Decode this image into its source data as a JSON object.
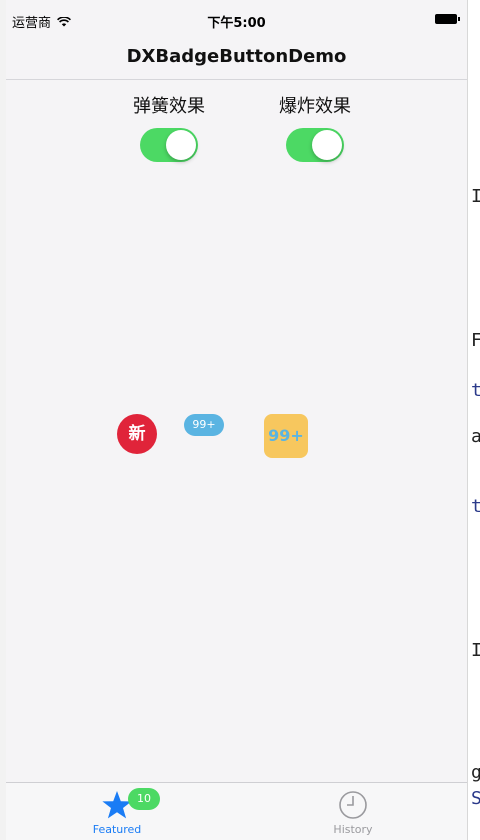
{
  "status_bar": {
    "carrier": "运营商",
    "time": "下午5:00"
  },
  "nav": {
    "title": "DXBadgeButtonDemo"
  },
  "switches": [
    {
      "label": "弹簧效果",
      "on": true
    },
    {
      "label": "爆炸效果",
      "on": true
    }
  ],
  "badges": {
    "new": {
      "text": "新",
      "color": "#e0243a"
    },
    "pill": {
      "text": "99+",
      "color": "#5ab4e2"
    },
    "square": {
      "text": "99+",
      "background": "#f7c75e",
      "text_color": "#5ab4e2"
    }
  },
  "tabs": [
    {
      "label": "Featured",
      "icon": "star-icon",
      "badge": "10",
      "selected": true
    },
    {
      "label": "History",
      "icon": "clock-icon",
      "selected": false
    }
  ],
  "colors": {
    "switch_on": "#4cd964",
    "tab_badge": "#4cd964",
    "tab_selected": "#1a7cf5"
  },
  "background_fragments": {
    "right": [
      "I",
      "F",
      "t",
      "a",
      "t",
      "I",
      "g",
      "S"
    ]
  }
}
